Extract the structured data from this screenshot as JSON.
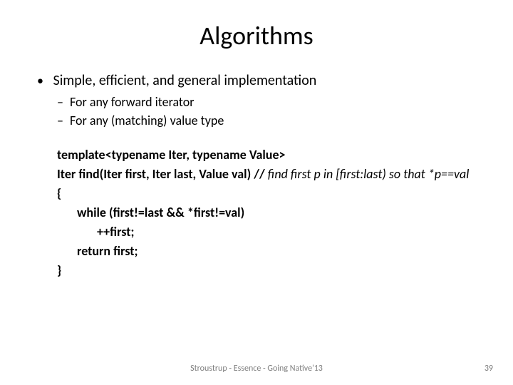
{
  "title": "Algorithms",
  "bullets": {
    "main": "Simple, efficient, and general implementation",
    "sub": [
      "For any forward iterator",
      "For any (matching) value type"
    ]
  },
  "code": {
    "l1": "template<typename Iter, typename Value>",
    "l2a": "Iter find(Iter first, Iter last, Value val) // ",
    "l2b": "find first p in [first:last) so that *p==val",
    "l3": "{",
    "l4": "while (first!=last && *first!=val)",
    "l5": "++first;",
    "l6": "return first;",
    "l7": "}"
  },
  "footer": "Stroustrup - Essence - Going Native'13",
  "page": "39"
}
